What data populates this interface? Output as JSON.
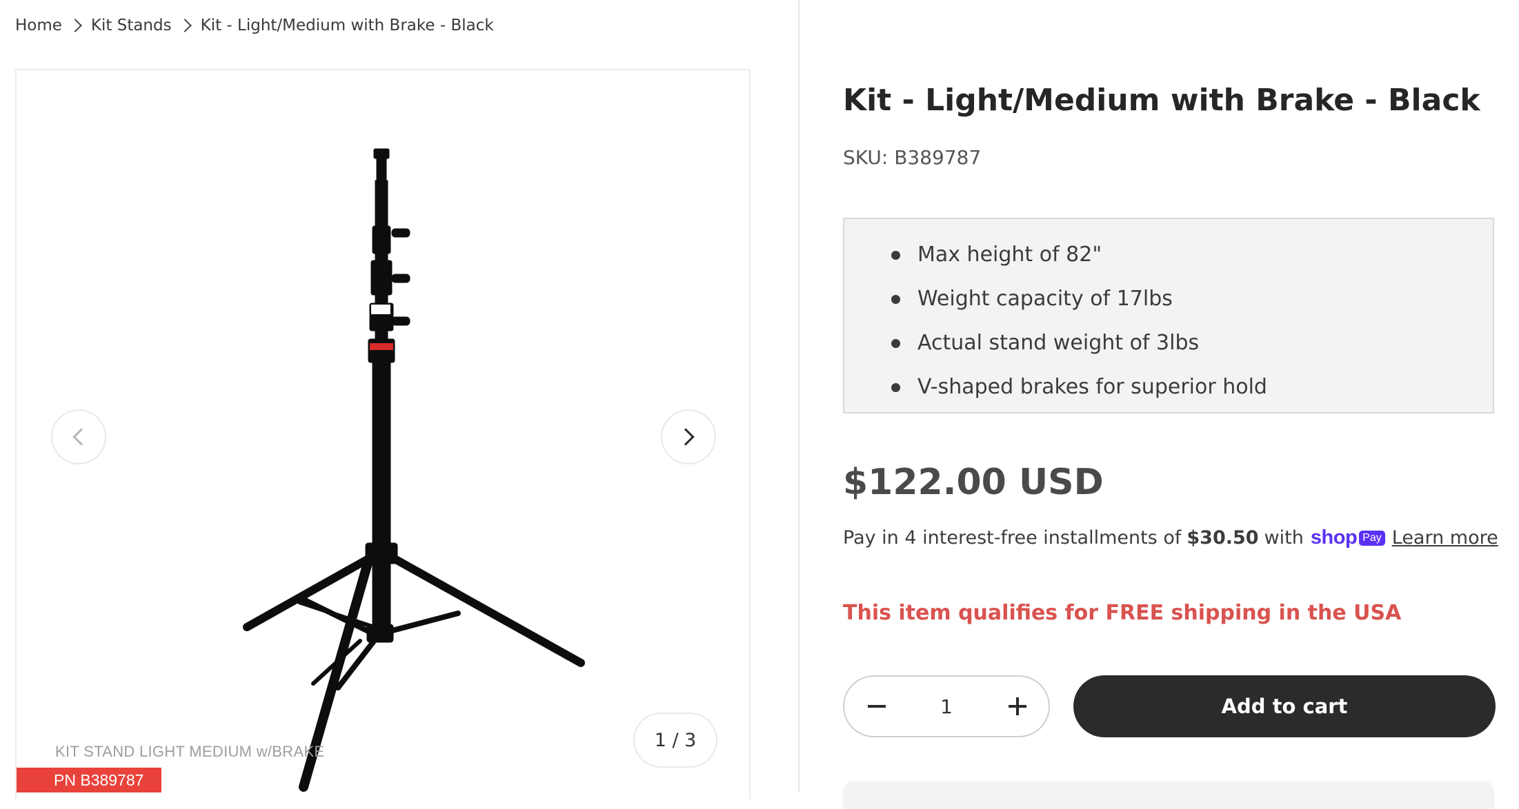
{
  "breadcrumb": {
    "items": [
      "Home",
      "Kit Stands",
      "Kit - Light/Medium with Brake - Black"
    ]
  },
  "gallery": {
    "counter": "1 / 3",
    "image_caption": "KIT STAND LIGHT MEDIUM w/BRAKE",
    "pn_badge": "PN B389787",
    "pn_badge_color": "#e8423b"
  },
  "product": {
    "title": "Kit - Light/Medium with Brake - Black",
    "sku": "SKU: B389787",
    "features": [
      "Max height of 82\"",
      "Weight capacity of 17lbs",
      "Actual stand weight of 3lbs",
      "V-shaped brakes for superior hold"
    ],
    "price": "$122.00 USD",
    "installments": {
      "prefix": "Pay in 4 interest-free installments of",
      "amount": "$30.50",
      "suffix": "with",
      "shop_word": "shop",
      "shop_pay": "Pay",
      "learn_more": "Learn more"
    },
    "shipping_notice": "This item qualifies for FREE shipping in the USA",
    "shipping_color": "#d9534f"
  },
  "cart": {
    "quantity": "1",
    "add_to_cart_label": "Add to cart",
    "button_color": "#2b2b2b"
  },
  "icons": {
    "decrease": "minus-icon",
    "increase": "plus-icon",
    "prev": "chevron-left-icon",
    "next": "chevron-right-icon",
    "separator": "chevron-right-icon"
  }
}
